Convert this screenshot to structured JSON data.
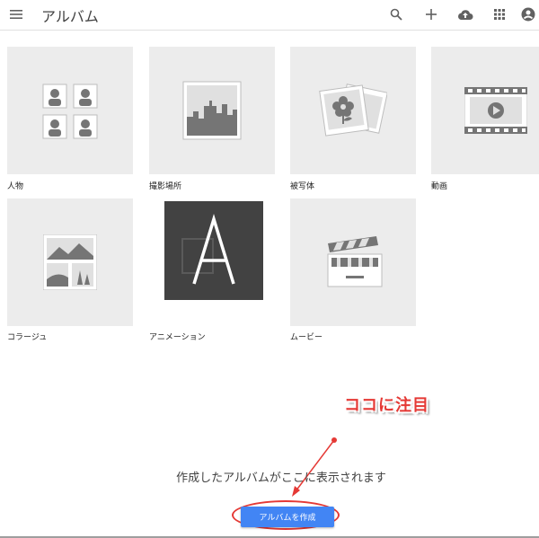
{
  "header": {
    "title": "アルバム"
  },
  "tiles": [
    {
      "label": "人物",
      "icon": "people-icon"
    },
    {
      "label": "撮影場所",
      "icon": "city-icon"
    },
    {
      "label": "被写体",
      "icon": "flower-photos-icon"
    },
    {
      "label": "動画",
      "icon": "film-icon"
    },
    {
      "label": "コラージュ",
      "icon": "collage-icon"
    },
    {
      "label": "アニメーション",
      "icon": "animation-a-icon"
    },
    {
      "label": "ムービー",
      "icon": "clapperboard-icon"
    }
  ],
  "empty_state": {
    "message": "作成したアルバムがここに表示されます"
  },
  "create_button": {
    "label": "アルバムを作成"
  },
  "annotation": {
    "callout": "ココに注目"
  },
  "colors": {
    "accent": "#4285f4",
    "annotation": "#e53935",
    "tile_bg": "#ececec"
  }
}
